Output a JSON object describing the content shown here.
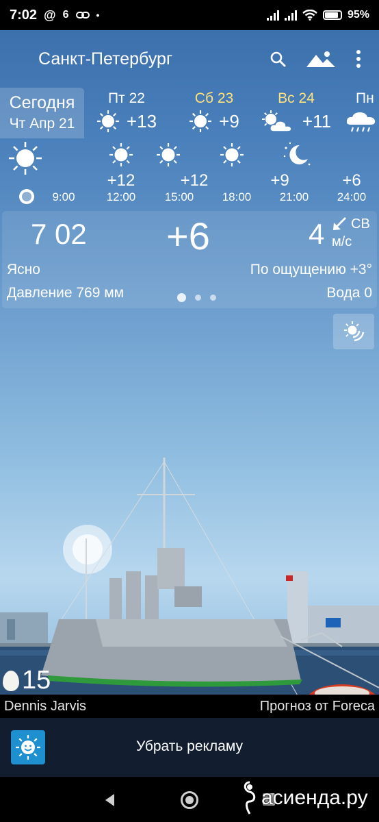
{
  "status_bar": {
    "time": "7:02",
    "at_symbol": "@",
    "notif_count": "6",
    "battery": "95%"
  },
  "toolbar": {
    "city": "Санкт-Петербург"
  },
  "days": [
    {
      "line1": "Сегодня",
      "line2": "Чт Апр 21",
      "icon": "sun-icon"
    },
    {
      "name": "Пт 22",
      "temp": "+13",
      "icon": "sun-icon",
      "weekend": false
    },
    {
      "name": "Сб 23",
      "temp": "+9",
      "icon": "sun-icon",
      "weekend": true
    },
    {
      "name": "Вс 24",
      "temp": "+11",
      "icon": "sun-cloud-icon",
      "weekend": true
    },
    {
      "name": "Пн",
      "temp": "",
      "icon": "rain-cloud-icon",
      "weekend": false
    }
  ],
  "hours": [
    {
      "time": "9:00",
      "temp": "",
      "icon": "sun-icon"
    },
    {
      "time": "12:00",
      "temp": "+12",
      "icon": "sun-icon"
    },
    {
      "time": "15:00",
      "temp": "+12",
      "icon": "sun-icon"
    },
    {
      "time": "18:00",
      "temp": "",
      "icon": "sun-icon"
    },
    {
      "time": "21:00",
      "temp": "+9",
      "icon": "moon-stars-icon"
    },
    {
      "time": "24:00",
      "temp": "+6",
      "icon": ""
    }
  ],
  "current": {
    "time": "7 02",
    "temp": "+6",
    "wind_speed": "4",
    "wind_dir": "СВ",
    "wind_unit": "м/с",
    "condition": "Ясно",
    "feels_like": "По ощущению +3°",
    "pressure": "Давление 769 мм",
    "water": "Вода 0",
    "pages": 3,
    "active_page": 1
  },
  "photo": {
    "egg_temp": "15",
    "author": "Dennis Jarvis",
    "source": "Прогноз от Foreca"
  },
  "ad": {
    "label": "Убрать рекламу"
  },
  "watermark": {
    "text": "асиенда.ру"
  },
  "colors": {
    "weekend": "#ffe27a",
    "ad_bg": "#121e30",
    "ad_icon_bg": "#1f90cf"
  }
}
